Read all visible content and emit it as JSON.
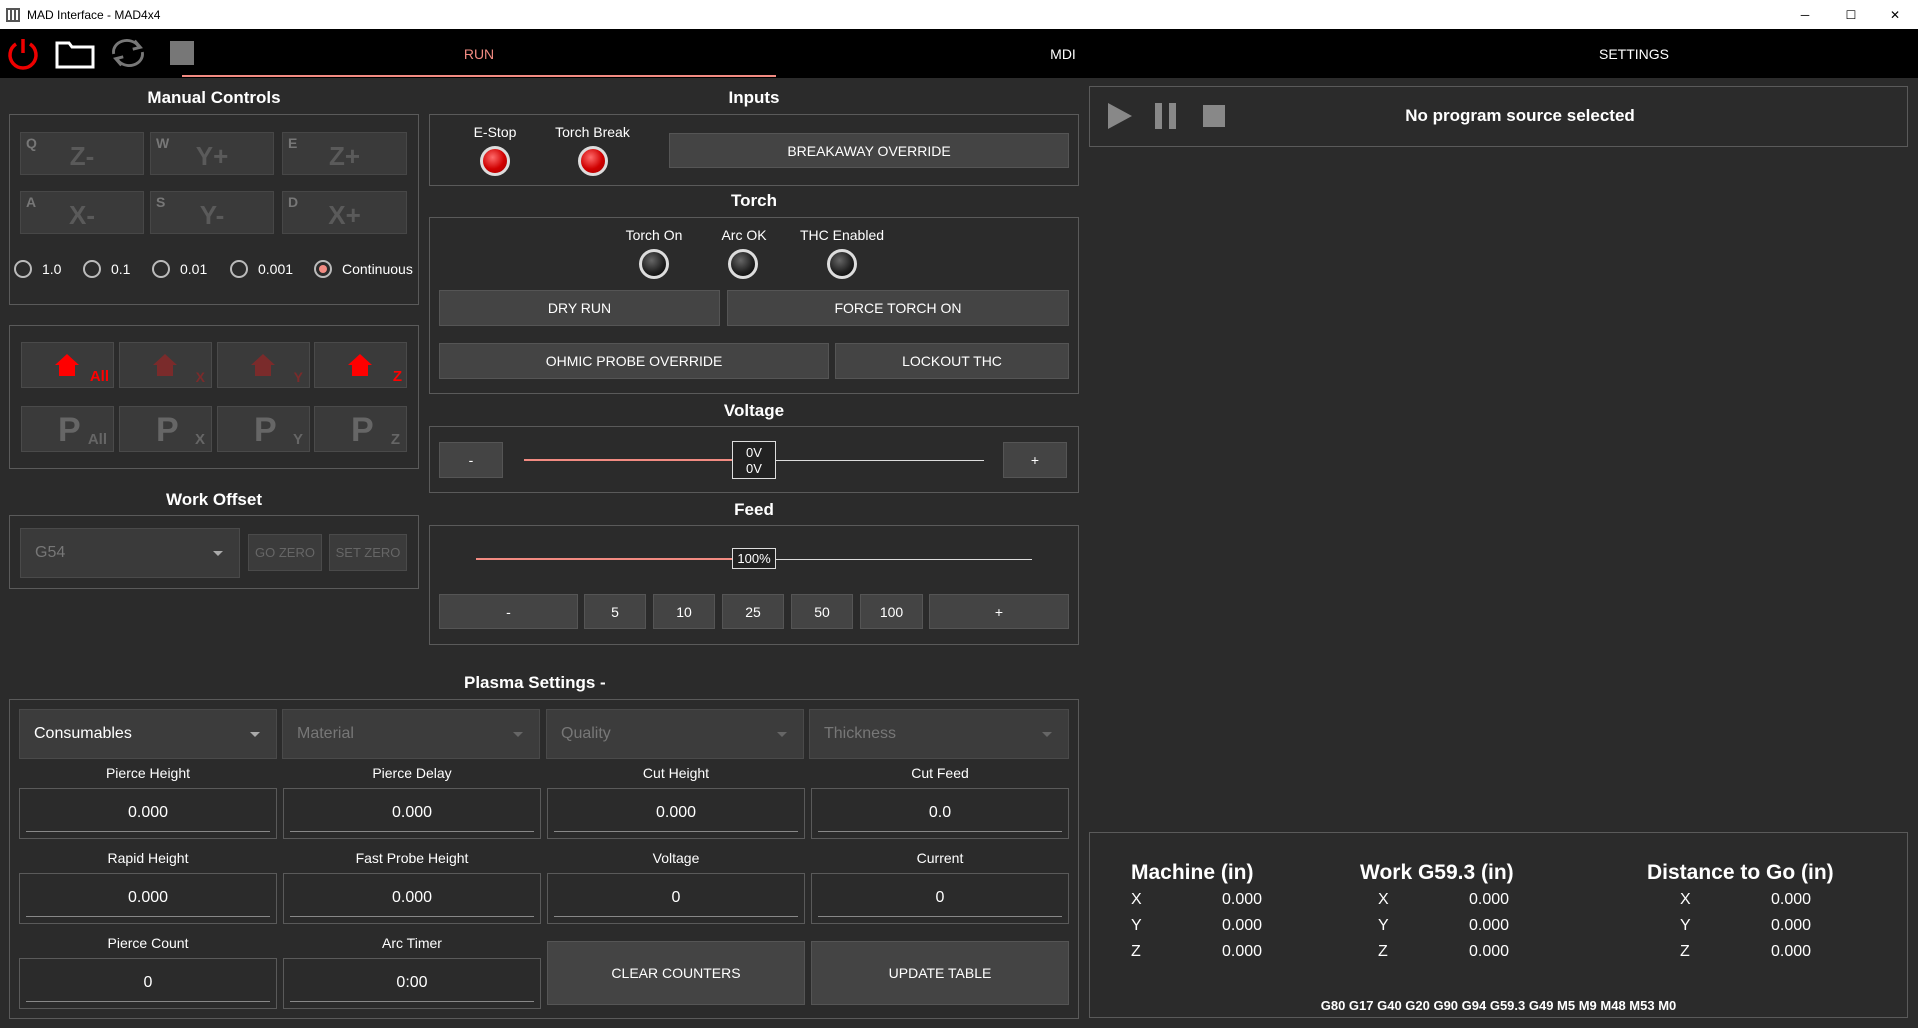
{
  "window": {
    "title": "MAD Interface - MAD4x4",
    "minimize": "─",
    "maximize": "☐",
    "close": "✕"
  },
  "toolbar": {
    "icons": [
      "power-icon",
      "folder-icon",
      "reload-icon",
      "stop-icon"
    ]
  },
  "tabs": {
    "run": "RUN",
    "mdi": "MDI",
    "settings": "SETTINGS"
  },
  "colors": {
    "accent": "#f28b82",
    "home_red": "#ff0000",
    "background": "#2b2b2b"
  },
  "manual": {
    "title": "Manual Controls",
    "jog": [
      {
        "key": "Q",
        "label": "Z-"
      },
      {
        "key": "W",
        "label": "Y+"
      },
      {
        "key": "E",
        "label": "Z+"
      },
      {
        "key": "A",
        "label": "X-"
      },
      {
        "key": "S",
        "label": "Y-"
      },
      {
        "key": "D",
        "label": "X+"
      }
    ],
    "increments": [
      "1.0",
      "0.1",
      "0.01",
      "0.001",
      "Continuous"
    ],
    "selected_increment": "Continuous",
    "home": [
      {
        "sub": "All"
      },
      {
        "sub": "X"
      },
      {
        "sub": "Y"
      },
      {
        "sub": "Z"
      }
    ],
    "probe": [
      {
        "letter": "P",
        "sub": "All"
      },
      {
        "letter": "P",
        "sub": "X"
      },
      {
        "letter": "P",
        "sub": "Y"
      },
      {
        "letter": "P",
        "sub": "Z"
      }
    ]
  },
  "work_offset": {
    "title": "Work Offset",
    "selected": "G54",
    "go_zero": "GO ZERO",
    "set_zero": "SET ZERO"
  },
  "inputs": {
    "title": "Inputs",
    "estop": "E-Stop",
    "torch_break": "Torch Break",
    "breakaway": "BREAKAWAY OVERRIDE"
  },
  "torch": {
    "title": "Torch",
    "torch_on": "Torch On",
    "arc_ok": "Arc OK",
    "thc_enabled": "THC Enabled",
    "dry_run": "DRY RUN",
    "force_on": "FORCE TORCH ON",
    "ohmic": "OHMIC PROBE OVERRIDE",
    "lockout": "LOCKOUT THC"
  },
  "voltage": {
    "title": "Voltage",
    "minus": "-",
    "plus": "+",
    "setpoint": "0V",
    "actual": "0V",
    "level": 0.5
  },
  "feed": {
    "title": "Feed",
    "value": "100%",
    "level": 0.5,
    "minus": "-",
    "plus": "+",
    "presets": [
      "5",
      "10",
      "25",
      "50",
      "100"
    ]
  },
  "plasma": {
    "title": "Plasma Settings -",
    "combos": [
      "Consumables",
      "Material",
      "Quality",
      "Thickness"
    ],
    "fields": [
      {
        "label": "Pierce Height",
        "value": "0.000"
      },
      {
        "label": "Pierce Delay",
        "value": "0.000"
      },
      {
        "label": "Cut Height",
        "value": "0.000"
      },
      {
        "label": "Cut Feed",
        "value": "0.0"
      },
      {
        "label": "Rapid Height",
        "value": "0.000"
      },
      {
        "label": "Fast Probe Height",
        "value": "0.000"
      },
      {
        "label": "Voltage",
        "value": "0"
      },
      {
        "label": "Current",
        "value": "0"
      },
      {
        "label": "Pierce Count",
        "value": "0"
      },
      {
        "label": "Arc Timer",
        "value": "0:00"
      }
    ],
    "clear_counters": "CLEAR COUNTERS",
    "update_table": "UPDATE TABLE"
  },
  "program": {
    "status": "No program source selected"
  },
  "dro": {
    "machine": {
      "title": "Machine (in)",
      "axes": [
        {
          "a": "X",
          "v": "0.000"
        },
        {
          "a": "Y",
          "v": "0.000"
        },
        {
          "a": "Z",
          "v": "0.000"
        }
      ]
    },
    "work": {
      "title": "Work G59.3 (in)",
      "axes": [
        {
          "a": "X",
          "v": "0.000"
        },
        {
          "a": "Y",
          "v": "0.000"
        },
        {
          "a": "Z",
          "v": "0.000"
        }
      ]
    },
    "dtg": {
      "title": "Distance to Go (in)",
      "axes": [
        {
          "a": "X",
          "v": "0.000"
        },
        {
          "a": "Y",
          "v": "0.000"
        },
        {
          "a": "Z",
          "v": "0.000"
        }
      ]
    },
    "gcodes": "G80 G17 G40 G20 G90 G94 G59.3 G49 M5 M9 M48 M53 M0"
  }
}
